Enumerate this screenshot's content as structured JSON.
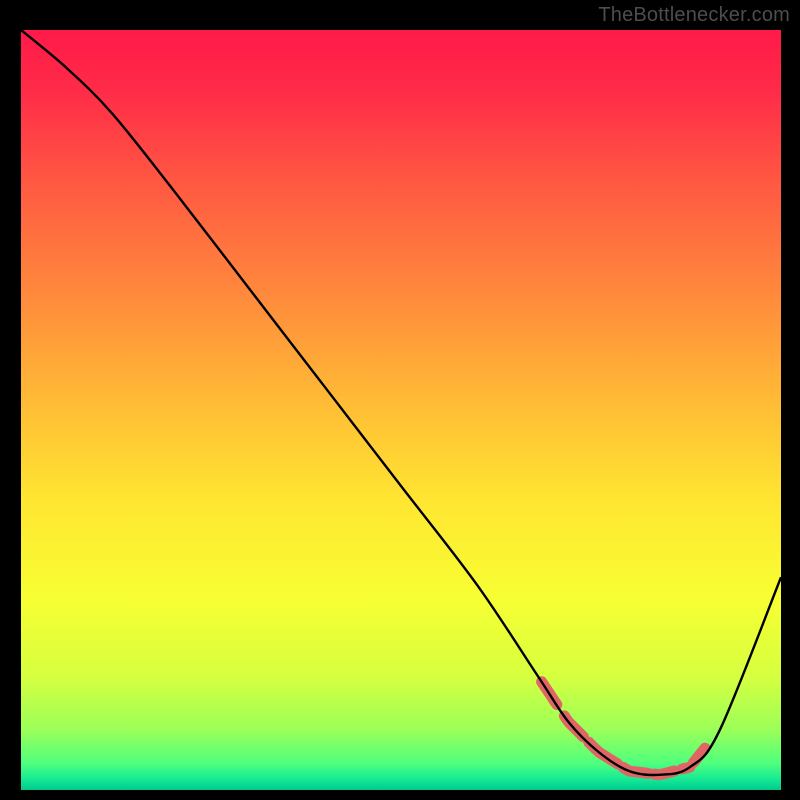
{
  "attribution": "TheBottlenecker.com",
  "chart_data": {
    "type": "line",
    "title": "",
    "xlabel": "",
    "ylabel": "",
    "xlim": [
      0,
      100
    ],
    "ylim": [
      0,
      100
    ],
    "background_gradient": [
      {
        "stop": 0.0,
        "color": "#ff1a49"
      },
      {
        "stop": 0.08,
        "color": "#ff2b48"
      },
      {
        "stop": 0.2,
        "color": "#ff5842"
      },
      {
        "stop": 0.35,
        "color": "#ff8a3c"
      },
      {
        "stop": 0.5,
        "color": "#ffbf35"
      },
      {
        "stop": 0.62,
        "color": "#ffe631"
      },
      {
        "stop": 0.75,
        "color": "#f7ff33"
      },
      {
        "stop": 0.85,
        "color": "#d6ff3f"
      },
      {
        "stop": 0.92,
        "color": "#9cff58"
      },
      {
        "stop": 0.965,
        "color": "#4fff7d"
      },
      {
        "stop": 0.985,
        "color": "#17eb94"
      },
      {
        "stop": 1.0,
        "color": "#00c98f"
      }
    ],
    "series": [
      {
        "name": "bottleneck-curve",
        "color": "#000000",
        "x": [
          0,
          6,
          12,
          20,
          30,
          40,
          50,
          60,
          68,
          72,
          76,
          80,
          84,
          88,
          92,
          100
        ],
        "y": [
          100,
          95,
          89,
          79,
          66,
          53,
          40,
          27,
          15,
          9,
          5,
          2.5,
          2,
          3,
          8,
          28
        ]
      }
    ],
    "optimal_band": {
      "color": "#e06666",
      "segments_x": [
        [
          68.5,
          70.5
        ],
        [
          71.5,
          74.0
        ],
        [
          74.7,
          78.5
        ],
        [
          79.2,
          82.5
        ],
        [
          83.3,
          86.0
        ],
        [
          87.0,
          88.0
        ],
        [
          88.5,
          90.0
        ]
      ],
      "y_for_x_hint": "follows the curve minimum ~2–9"
    }
  }
}
